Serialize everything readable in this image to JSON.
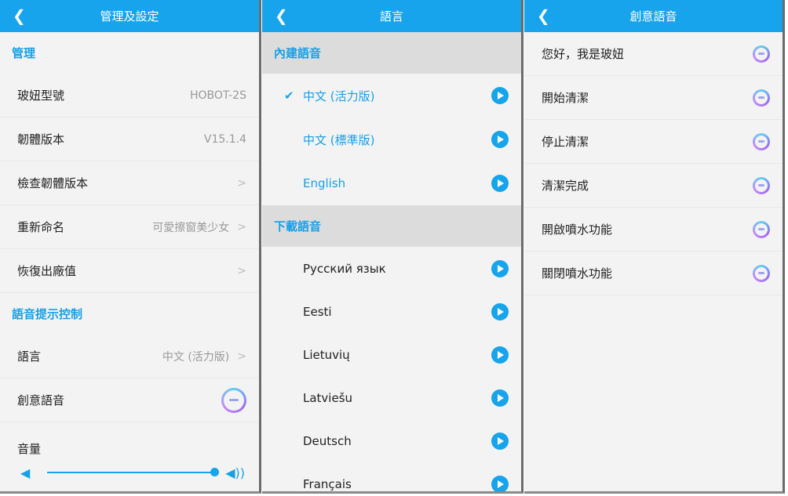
{
  "settings": {
    "title": "管理及設定",
    "section_manage": "管理",
    "rows": [
      {
        "label": "玻妞型號",
        "value": "HOBOT-2S"
      },
      {
        "label": "韌體版本",
        "value": "V15.1.4"
      },
      {
        "label": "檢查韌體版本",
        "value": ""
      },
      {
        "label": "重新命名",
        "value": "可愛擦窗美少女"
      },
      {
        "label": "恢復出廠值",
        "value": ""
      }
    ],
    "section_voice": "語音提示控制",
    "language_label": "語言",
    "language_value": "中文 (活力版)",
    "creative_label": "創意語音",
    "volume_label": "音量",
    "volume_level": 1.0
  },
  "language": {
    "title": "語言",
    "builtin_header": "內建語音",
    "builtin": [
      {
        "label": "中文 (活力版)",
        "selected": true
      },
      {
        "label": "中文 (標準版)",
        "selected": false
      },
      {
        "label": "English",
        "selected": false
      }
    ],
    "download_header": "下載語音",
    "downloads": [
      "Русский язык",
      "Eesti",
      "Lietuvių",
      "Latviešu",
      "Deutsch",
      "Français"
    ]
  },
  "creative": {
    "title": "創意語音",
    "items": [
      "您好，我是玻妞",
      "開始清潔",
      "停止清潔",
      "清潔完成",
      "開啟噴水功能",
      "關閉噴水功能"
    ]
  },
  "colors": {
    "accent": "#17a4ec",
    "background": "#f3f3f3"
  }
}
